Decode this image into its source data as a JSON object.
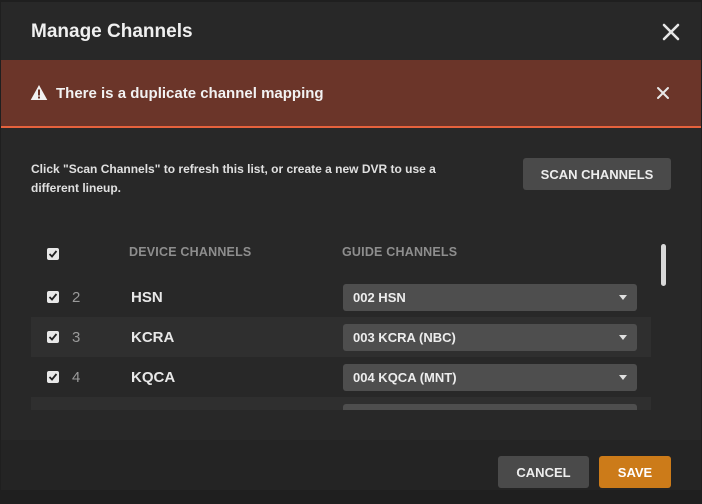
{
  "modal": {
    "title": "Manage Channels",
    "close_icon": "close-icon"
  },
  "alert": {
    "icon": "warning-icon",
    "message": "There is a duplicate channel mapping",
    "close_icon": "close-icon"
  },
  "intro": {
    "text": "Click \"Scan Channels\" to refresh this list, or create a new DVR to use a different lineup.",
    "scan_label": "SCAN CHANNELS"
  },
  "table": {
    "select_all_checked": true,
    "headers": {
      "device": "DEVICE CHANNELS",
      "guide": "GUIDE CHANNELS"
    },
    "rows": [
      {
        "checked": true,
        "number": "2",
        "device": "HSN",
        "guide": "002 HSN"
      },
      {
        "checked": true,
        "number": "3",
        "device": "KCRA",
        "guide": "003 KCRA (NBC)"
      },
      {
        "checked": true,
        "number": "4",
        "device": "KQCA",
        "guide": "004 KQCA (MNT)"
      },
      {
        "checked": true,
        "number": "",
        "device": "",
        "guide": ""
      }
    ]
  },
  "footer": {
    "cancel_label": "CANCEL",
    "save_label": "SAVE"
  },
  "colors": {
    "alert_bg": "#6b3529",
    "alert_border": "#e5623d",
    "save_accent": "#cc7b19",
    "modal_bg": "#282828"
  }
}
